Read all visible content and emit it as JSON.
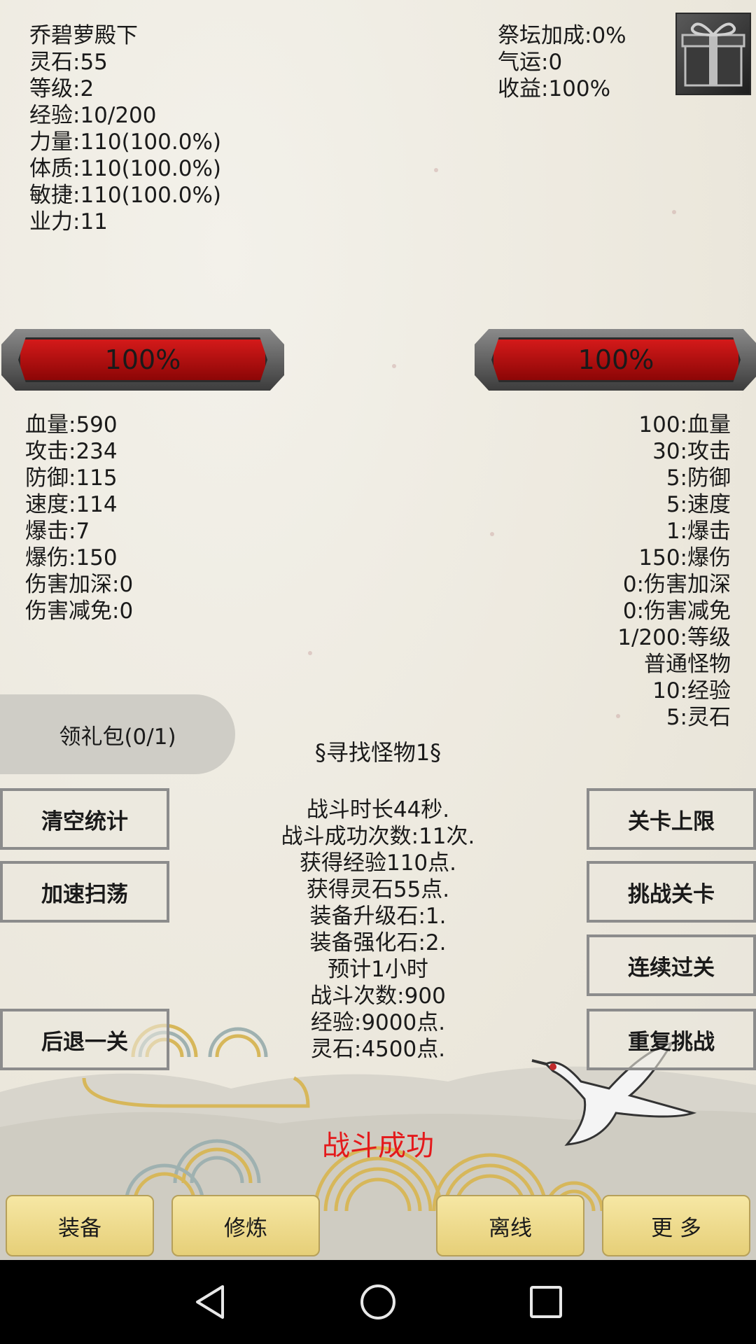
{
  "player": {
    "name": "乔碧萝殿下",
    "spirit_stone": "灵石:55",
    "level": "等级:2",
    "exp": "经验:10/200",
    "strength": "力量:110(100.0%)",
    "physique": "体质:110(100.0%)",
    "agility": "敏捷:110(100.0%)",
    "karma": "业力:11"
  },
  "bonus": {
    "altar": "祭坛加成:0%",
    "luck": "气运:0",
    "income": "收益:100%"
  },
  "gift_icon": "gift-box-icon",
  "hp": {
    "player_label": "100%",
    "player_value": 1.0,
    "enemy_label": "100%",
    "enemy_value": 1.0
  },
  "player_stats": [
    "血量:590",
    "攻击:234",
    "防御:115",
    "速度:114",
    "爆击:7",
    "爆伤:150",
    "伤害加深:0",
    "伤害减免:0"
  ],
  "enemy_stats": [
    "100:血量",
    "30:攻击",
    "5:防御",
    "5:速度",
    "1:爆击",
    "150:爆伤",
    "0:伤害加深",
    "0:伤害减免",
    "1/200:等级",
    "普通怪物",
    "10:经验",
    "5:灵石"
  ],
  "gift_button": "领礼包(0/1)",
  "search_title": "§寻找怪物1§",
  "battle_log": [
    "战斗时长44秒.",
    "战斗成功次数:11次.",
    "获得经验110点.",
    "获得灵石55点.",
    "装备升级石:1.",
    "装备强化石:2.",
    "预计1小时",
    "战斗次数:900",
    "经验:9000点.",
    "灵石:4500点."
  ],
  "left_buttons": {
    "clear": "清空统计",
    "speed": "加速扫荡",
    "back": "后退一关"
  },
  "right_buttons": {
    "limit": "关卡上限",
    "challenge": "挑战关卡",
    "continuous": "连续过关",
    "repeat": "重复挑战"
  },
  "victory": "战斗成功",
  "tabs": [
    "装备",
    "修炼",
    "离线",
    "更 多"
  ],
  "colors": {
    "victory": "#e4191b",
    "hp_fill": "#c01010",
    "tab_bg": "#f0dc8e"
  }
}
